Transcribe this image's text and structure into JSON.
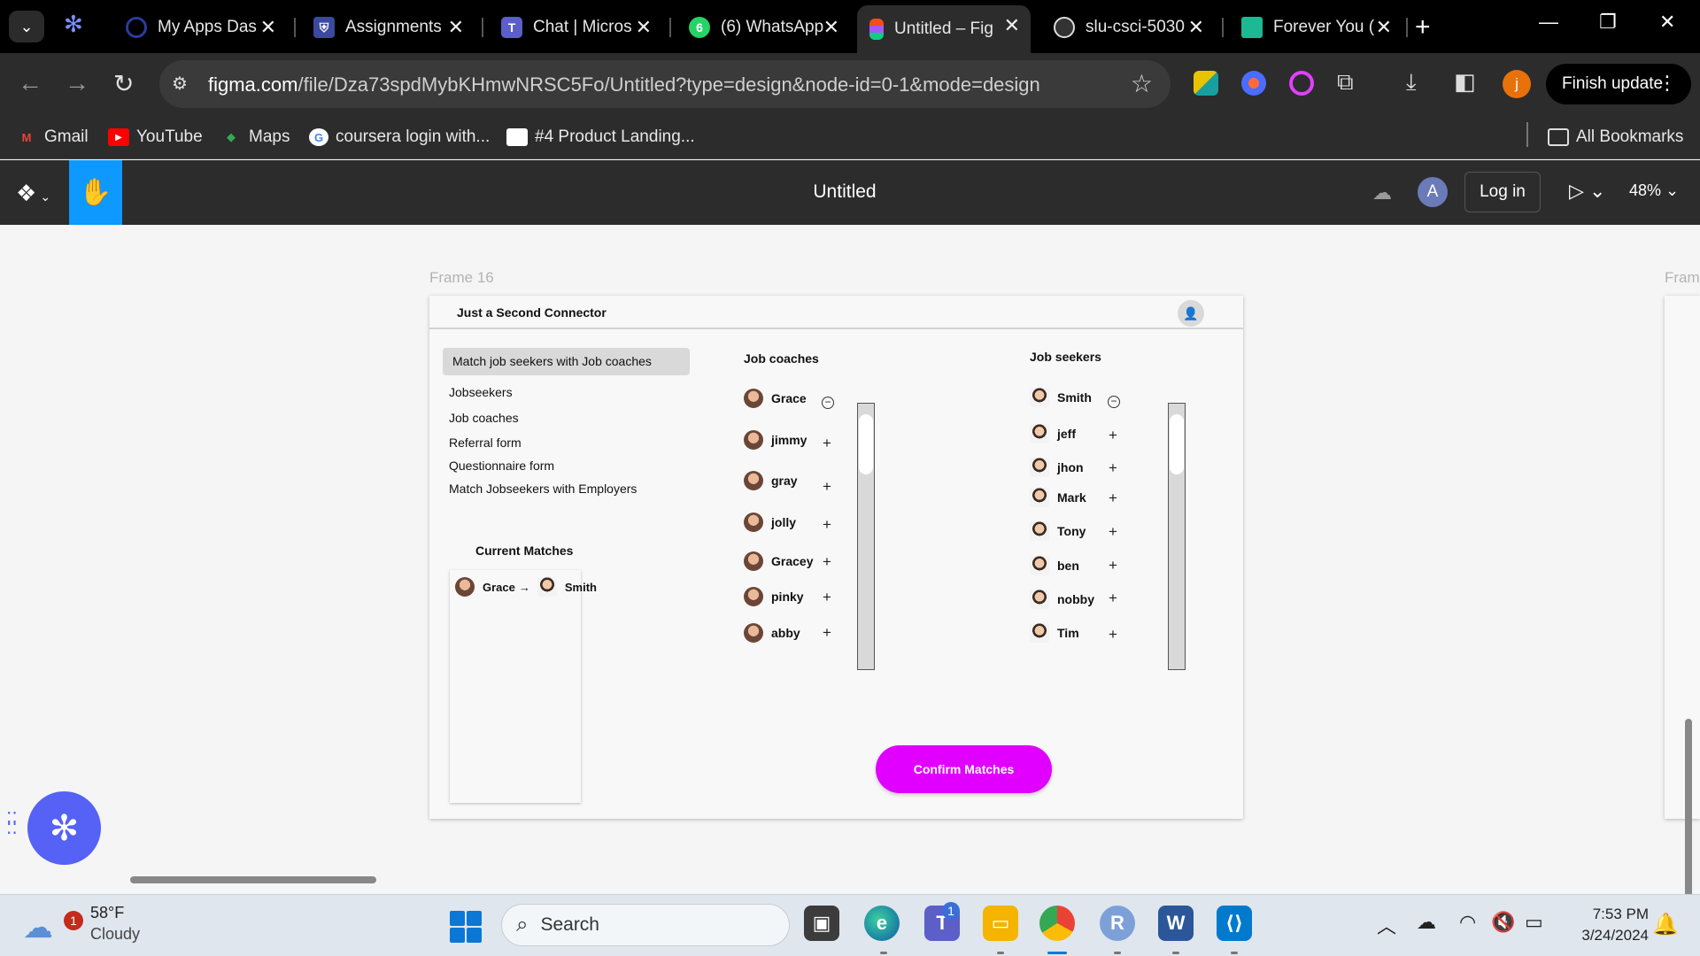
{
  "browser": {
    "tabs": [
      {
        "title": "My Apps Das",
        "color": "#1e2a78"
      },
      {
        "title": "Assignments",
        "color": "#3b4a9c"
      },
      {
        "title": "Chat | Micros",
        "color": "#5b5fc7"
      },
      {
        "title": "(6) WhatsApp",
        "color": "#25d366"
      },
      {
        "title": "Untitled – Fig",
        "color": "#f24e1e"
      },
      {
        "title": "slu-csci-5030",
        "color": "#333333"
      },
      {
        "title": "Forever You (",
        "color": "#1db993"
      }
    ],
    "url_domain": "figma.com",
    "url_path": "/file/Dza73spdMybKHmwNRSC5Fo/Untitled?type=design&node-id=0-1&mode=design",
    "finish_update": "Finish update",
    "profile_initial": "j"
  },
  "bookmarks": [
    {
      "label": "Gmail",
      "icon": "M",
      "color": "#ea4335"
    },
    {
      "label": "YouTube",
      "icon": "▶",
      "color": "#ff0000"
    },
    {
      "label": "Maps",
      "icon": "◆",
      "color": "#34a853"
    },
    {
      "label": "coursera login with...",
      "icon": "G",
      "color": "#ffffff"
    },
    {
      "label": "#4 Product Landing...",
      "icon": "",
      "color": "#ffffff"
    }
  ],
  "all_bookmarks": "All Bookmarks",
  "figma": {
    "file_title": "Untitled",
    "avatar_initial": "A",
    "login_label": "Log in",
    "zoom": "48%"
  },
  "canvas": {
    "frame_label": "Frame 16",
    "next_frame_label": "Fram",
    "app": {
      "name": "Just a Second Connector",
      "nav_active": "Match job seekers with Job coaches",
      "nav_items": [
        "Jobseekers",
        "Job coaches",
        "Referral form",
        "Questionnaire form",
        "Match Jobseekers with Employers"
      ],
      "current_matches_title": "Current Matches",
      "current_match": {
        "coach": "Grace",
        "arrow": "→",
        "seeker": "Smith"
      },
      "coaches_title": "Job coaches",
      "seekers_title": "Job seekers",
      "coaches": [
        {
          "name": "Grace",
          "action": "−"
        },
        {
          "name": "jimmy",
          "action": "+"
        },
        {
          "name": "gray",
          "action": "+"
        },
        {
          "name": "jolly",
          "action": "+"
        },
        {
          "name": "Gracey",
          "action": "+"
        },
        {
          "name": "pinky",
          "action": "+"
        },
        {
          "name": "abby",
          "action": "+"
        }
      ],
      "seekers": [
        {
          "name": "Smith",
          "action": "−"
        },
        {
          "name": "jeff",
          "action": "+"
        },
        {
          "name": "jhon",
          "action": "+"
        },
        {
          "name": "Mark",
          "action": "+"
        },
        {
          "name": "Tony",
          "action": "+"
        },
        {
          "name": "ben",
          "action": "+"
        },
        {
          "name": "nobby",
          "action": "+"
        },
        {
          "name": "Tim",
          "action": "+"
        }
      ],
      "confirm_label": "Confirm Matches",
      "confirm_color": "#e100ff"
    }
  },
  "taskbar": {
    "weather_temp": "58°F",
    "weather_desc": "Cloudy",
    "weather_badge": "1",
    "search_placeholder": "Search",
    "time": "7:53 PM",
    "date": "3/24/2024",
    "teams_badge": "1"
  }
}
